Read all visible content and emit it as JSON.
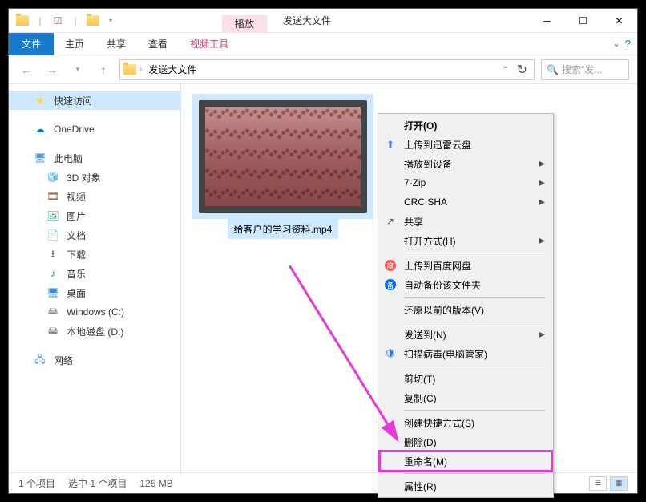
{
  "titlebar": {
    "context_tab": "播放",
    "title": "发送大文件"
  },
  "ribbon": {
    "file": "文件",
    "tabs": [
      "主页",
      "共享",
      "查看"
    ],
    "contextual": "视频工具"
  },
  "address": {
    "crumb": "发送大文件",
    "search_placeholder": "搜索\"发..."
  },
  "nav": {
    "quick_access": "快速访问",
    "onedrive": "OneDrive",
    "this_pc": "此电脑",
    "items": [
      {
        "label": "3D 对象",
        "icon": "cube"
      },
      {
        "label": "视频",
        "icon": "video"
      },
      {
        "label": "图片",
        "icon": "pic"
      },
      {
        "label": "文档",
        "icon": "doc"
      },
      {
        "label": "下载",
        "icon": "dl"
      },
      {
        "label": "音乐",
        "icon": "music"
      },
      {
        "label": "桌面",
        "icon": "desk"
      },
      {
        "label": "Windows (C:)",
        "icon": "drive"
      },
      {
        "label": "本地磁盘 (D:)",
        "icon": "drive"
      }
    ],
    "network": "网络"
  },
  "file": {
    "name": "给客户的学习资料.mp4"
  },
  "context_menu": [
    {
      "label": "打开(O)",
      "bold": true
    },
    {
      "label": "上传到迅雷云盘",
      "icon": "xunlei"
    },
    {
      "label": "播放到设备",
      "submenu": true
    },
    {
      "label": "7-Zip",
      "submenu": true
    },
    {
      "label": "CRC SHA",
      "submenu": true
    },
    {
      "label": "共享",
      "icon": "share"
    },
    {
      "label": "打开方式(H)",
      "submenu": true
    },
    {
      "sep": true
    },
    {
      "label": "上传到百度网盘",
      "icon": "baidu"
    },
    {
      "label": "自动备份该文件夹",
      "icon": "baidu2"
    },
    {
      "sep": true
    },
    {
      "label": "还原以前的版本(V)"
    },
    {
      "sep": true
    },
    {
      "label": "发送到(N)",
      "submenu": true
    },
    {
      "label": "扫描病毒(电脑管家)",
      "icon": "shield"
    },
    {
      "sep": true
    },
    {
      "label": "剪切(T)"
    },
    {
      "label": "复制(C)"
    },
    {
      "sep": true
    },
    {
      "label": "创建快捷方式(S)"
    },
    {
      "label": "删除(D)"
    },
    {
      "label": "重命名(M)",
      "highlighted": true
    },
    {
      "sep": true
    },
    {
      "label": "属性(R)"
    }
  ],
  "status": {
    "items": "1 个项目",
    "selected": "选中 1 个项目",
    "size": "125 MB"
  }
}
